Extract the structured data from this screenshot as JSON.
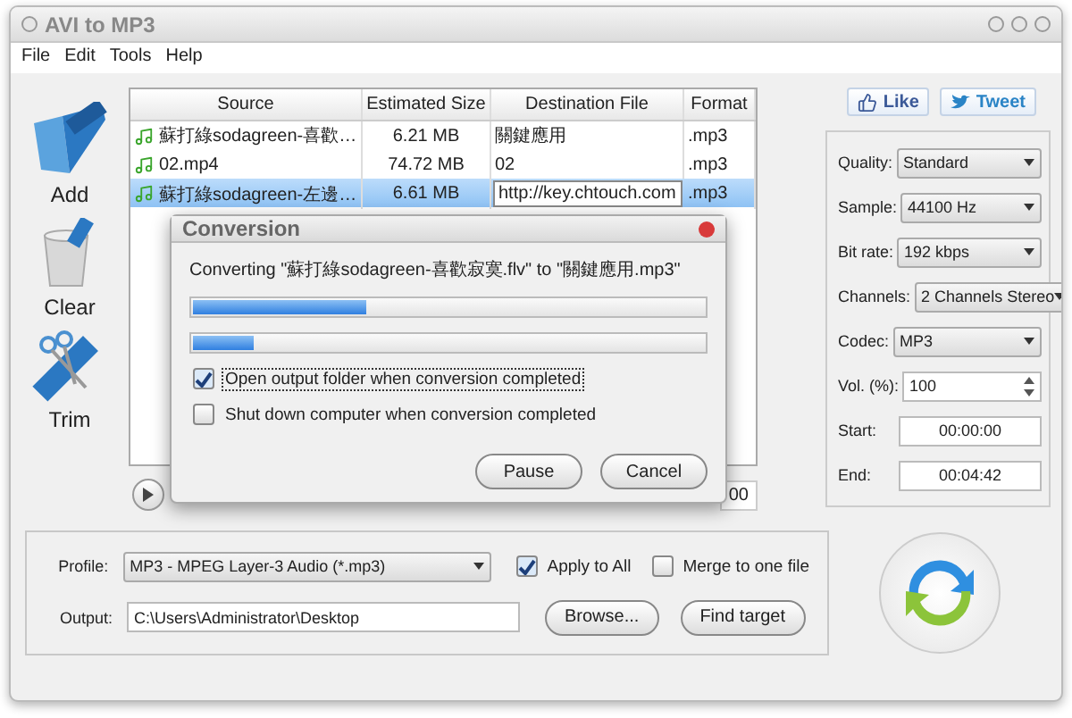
{
  "window": {
    "title": "AVI to MP3"
  },
  "menu": [
    "File",
    "Edit",
    "Tools",
    "Help"
  ],
  "tools": [
    {
      "kind": "add",
      "label": "Add"
    },
    {
      "kind": "clear",
      "label": "Clear"
    },
    {
      "kind": "trim",
      "label": "Trim"
    }
  ],
  "table": {
    "columns": [
      "Source",
      "Estimated Size",
      "Destination File",
      "Format"
    ],
    "rows": [
      {
        "source": "蘇打綠sodagreen-喜歡…",
        "size": "6.21 MB",
        "destination": "關鍵應用",
        "format": ".mp3",
        "selected": false,
        "editing": false
      },
      {
        "source": "02.mp4",
        "size": "74.72 MB",
        "destination": "02",
        "format": ".mp3",
        "selected": false,
        "editing": false
      },
      {
        "source": "蘇打綠sodagreen-左邊…",
        "size": "6.61 MB",
        "destination": "http://key.chtouch.com",
        "format": ".mp3",
        "selected": true,
        "editing": true
      }
    ]
  },
  "player": {
    "time": "00"
  },
  "social": [
    {
      "kind": "like",
      "label": "Like"
    },
    {
      "kind": "tweet",
      "label": "Tweet"
    }
  ],
  "settings": [
    {
      "kind": "select",
      "label": "Quality:",
      "value": "Standard"
    },
    {
      "kind": "select",
      "label": "Sample:",
      "value": "44100 Hz"
    },
    {
      "kind": "select",
      "label": "Bit rate:",
      "value": "192 kbps"
    },
    {
      "kind": "select",
      "label": "Channels:",
      "value": "2 Channels Stereo"
    },
    {
      "kind": "select",
      "label": "Codec:",
      "value": "MP3"
    },
    {
      "kind": "spin",
      "label": "Vol. (%):",
      "value": "100"
    },
    {
      "kind": "time",
      "label": "Start:",
      "value": "00:00:00"
    },
    {
      "kind": "time",
      "label": "End:",
      "value": "00:04:42"
    }
  ],
  "profile": {
    "label": "Profile:",
    "value": "MP3 - MPEG Layer-3 Audio (*.mp3)"
  },
  "options": [
    {
      "label": "Apply to All",
      "checked": true
    },
    {
      "label": "Merge to one file",
      "checked": false
    }
  ],
  "output": {
    "label": "Output:",
    "value": "C:\\Users\\Administrator\\Desktop"
  },
  "buttons": [
    "Browse...",
    "Find target"
  ],
  "dialog": {
    "title": "Conversion",
    "message": "Converting \"蘇打綠sodagreen-喜歡寂寞.flv\" to \"關鍵應用.mp3\"",
    "progress": [
      {
        "level": 0.34
      },
      {
        "level": 0.12
      }
    ],
    "options": [
      {
        "label": "Open output folder when conversion completed",
        "checked": true,
        "focused": true
      },
      {
        "label": "Shut down computer when conversion completed",
        "checked": false,
        "focused": false
      }
    ],
    "buttons": [
      "Pause",
      "Cancel"
    ]
  }
}
